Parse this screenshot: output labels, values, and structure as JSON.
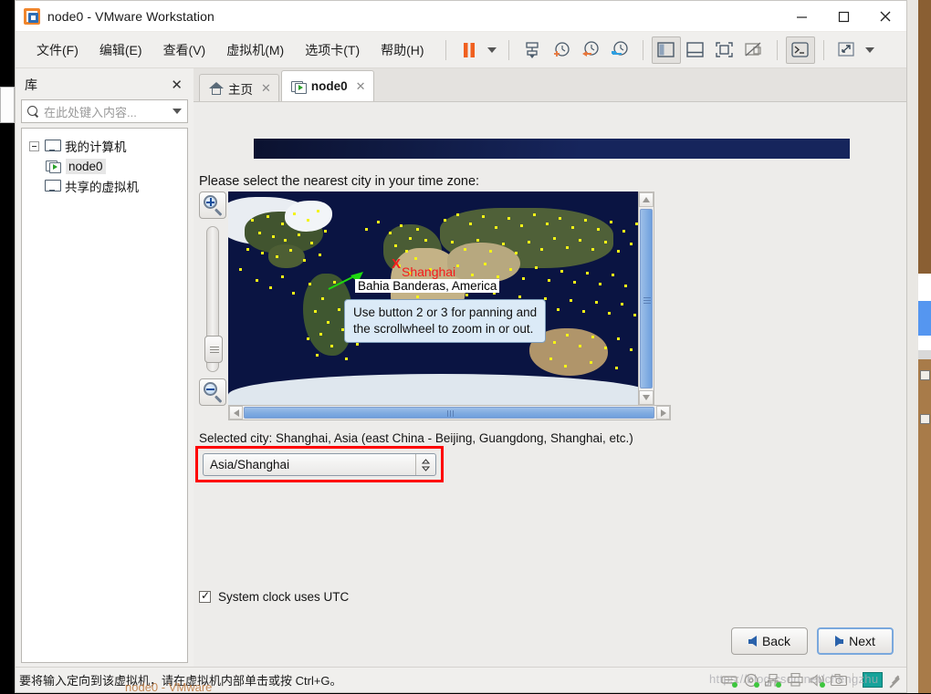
{
  "window": {
    "title": "node0 - VMware Workstation",
    "logo_icon": "vmware-logo-icon",
    "controls": [
      {
        "name": "minimize-button",
        "glyph": "—"
      },
      {
        "name": "maximize-button",
        "glyph": "▢"
      },
      {
        "name": "close-button",
        "glyph": "✕"
      }
    ]
  },
  "menubar": {
    "items": [
      {
        "label": "文件(F)",
        "name": "menu-file"
      },
      {
        "label": "编辑(E)",
        "name": "menu-edit"
      },
      {
        "label": "查看(V)",
        "name": "menu-view"
      },
      {
        "label": "虚拟机(M)",
        "name": "menu-vm"
      },
      {
        "label": "选项卡(T)",
        "name": "menu-tabs"
      },
      {
        "label": "帮助(H)",
        "name": "menu-help"
      }
    ],
    "toolbar": [
      {
        "name": "pause-vm-button",
        "icon": "pause-icon"
      },
      {
        "name": "power-dropdown-button",
        "icon": "chevron-down-icon"
      },
      {
        "name": "manage-snapshots-button",
        "icon": "snapshot-manager-icon"
      },
      {
        "name": "take-snapshot-button",
        "icon": "clock-plus-icon"
      },
      {
        "name": "revert-snapshot-button",
        "icon": "clock-back-icon"
      },
      {
        "name": "snapshot-settings-button",
        "icon": "clock-wrench-icon"
      },
      {
        "name": "show-library-button",
        "icon": "library-panel-icon"
      },
      {
        "name": "show-thumbnail-bar-button",
        "icon": "thumbnail-bar-icon"
      },
      {
        "name": "fullscreen-button",
        "icon": "fullscreen-icon"
      },
      {
        "name": "unity-mode-button",
        "icon": "unity-mode-icon"
      },
      {
        "name": "console-button",
        "icon": "terminal-icon"
      },
      {
        "name": "stretch-button",
        "icon": "expand-arrows-icon"
      },
      {
        "name": "stretch-dropdown-button",
        "icon": "chevron-down-icon"
      }
    ]
  },
  "sidebar": {
    "title": "库",
    "close_glyph": "✕",
    "search": {
      "placeholder": "在此处键入内容...",
      "icon": "search-icon",
      "dropdown_icon": "chevron-down-icon"
    },
    "tree": [
      {
        "label": "我的计算机",
        "icon": "monitor-icon",
        "expander": "collapse-box",
        "selected": false
      },
      {
        "label": "node0",
        "icon": "vm-icon",
        "selected": true
      },
      {
        "label": "共享的虚拟机",
        "icon": "shared-vm-icon",
        "selected": false
      }
    ]
  },
  "tabs": [
    {
      "label": "主页",
      "icon": "home-icon",
      "active": false,
      "close_glyph": "✕"
    },
    {
      "label": "node0",
      "icon": "vm-icon",
      "active": true,
      "close_glyph": "✕"
    }
  ],
  "vm_screen": {
    "prompt": "Please select the nearest city in your time zone:",
    "map": {
      "zoom_in_label": "zoom-in",
      "zoom_out_label": "zoom-out",
      "selected_marker": "X",
      "selected_marker_label": "Shanghai",
      "hover_tooltip": "Bahia Banderas, America",
      "hint": "Use button 2 or 3 for panning and\nthe scrollwheel to zoom in or out.",
      "hint_line1": "Use button 2 or 3 for panning and",
      "hint_line2": "the scrollwheel to zoom in or out.",
      "ocean_color": "#0a1442",
      "city_dot_color": "#f4f417",
      "marker_color": "#f41b1b"
    },
    "selected_city": "Selected city: Shanghai, Asia (east China - Beijing, Guangdong, Shanghai, etc.)",
    "timezone_value": "Asia/Shanghai",
    "highlight_color": "#fe0000",
    "utc_checkbox_label": "System clock uses UTC",
    "utc_checked": true,
    "buttons": {
      "back": "Back",
      "next": "Next"
    }
  },
  "statusbar": {
    "message": "要将输入定向到该虚拟机，请在虚拟机内部单击或按 Ctrl+G。",
    "watermark": "https://blog.csdn.net/chengzhu",
    "watermark_bottom": "node0 - VMware",
    "devices": [
      {
        "name": "hard-disk-icon"
      },
      {
        "name": "cd-dvd-icon"
      },
      {
        "name": "network-adapter-icon"
      },
      {
        "name": "printer-icon"
      },
      {
        "name": "sound-card-icon"
      },
      {
        "name": "camera-icon"
      }
    ]
  }
}
